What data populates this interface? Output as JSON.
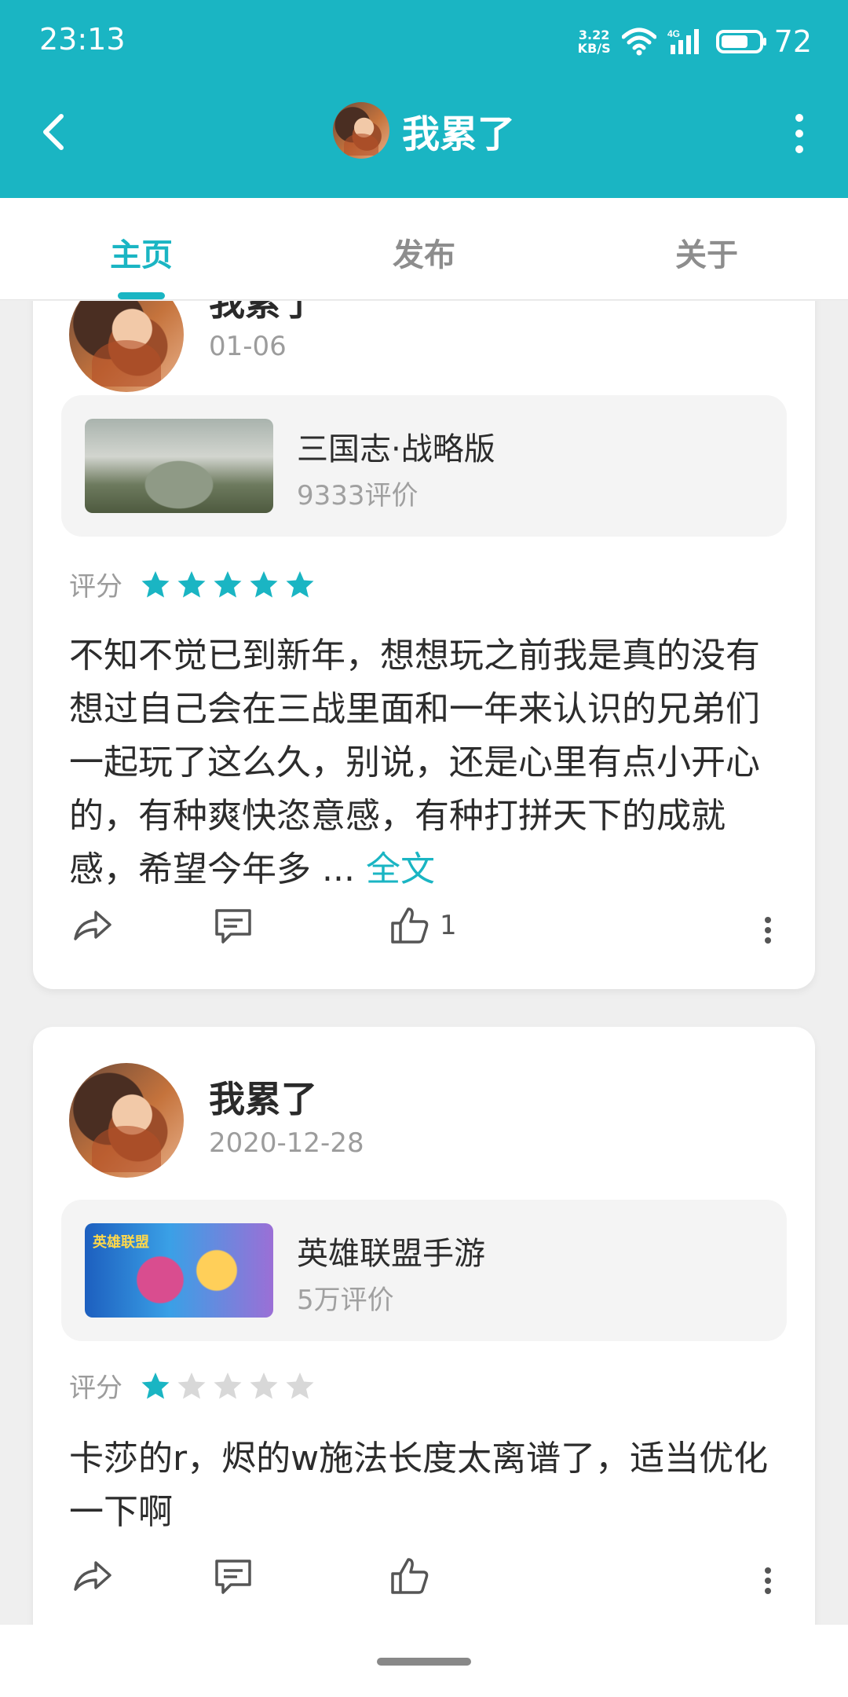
{
  "status_bar": {
    "time": "23:13",
    "net_speed_value": "3.22",
    "net_speed_unit": "KB/S",
    "network_type": "4G",
    "battery": "72",
    "battery_level": 0.72
  },
  "header": {
    "title": "我累了"
  },
  "tabs": [
    {
      "label": "主页",
      "active": true
    },
    {
      "label": "发布",
      "active": false
    },
    {
      "label": "关于",
      "active": false
    }
  ],
  "reviews": [
    {
      "user": "我累了",
      "date": "01-06",
      "game": {
        "name": "三国志·战略版",
        "count": "9333评价"
      },
      "rating_label": "评分",
      "stars": 5,
      "text": "不知不觉已到新年，想想玩之前我是真的没有想过自己会在三战里面和一年来认识的兄弟们一起玩了这么久，别说，还是心里有点小开心的，有种爽快恣意感，有种打拼天下的成就感，希望今年多 ...",
      "more": "全文",
      "likes": "1"
    },
    {
      "user": "我累了",
      "date": "2020-12-28",
      "game": {
        "name": "英雄联盟手游",
        "count": "5万评价",
        "brand": "英雄联盟"
      },
      "rating_label": "评分",
      "stars": 1,
      "text": "卡莎的r，烬的w施法长度太离谱了，适当优化一下啊",
      "likes": ""
    }
  ],
  "colors": {
    "accent": "#1ab5c3",
    "star_on": "#1ab5c3",
    "star_off": "#d8d8d8"
  }
}
